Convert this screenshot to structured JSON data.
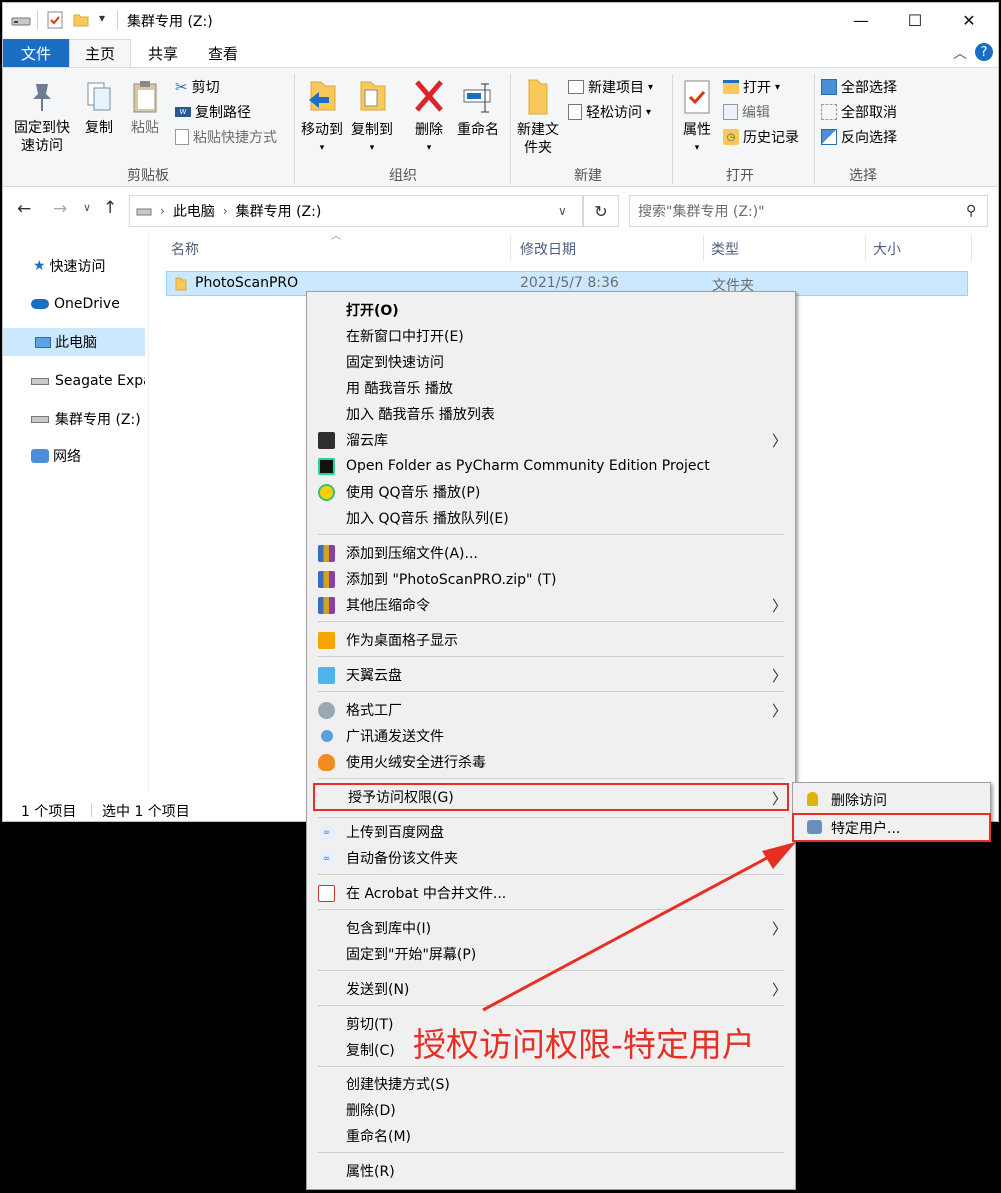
{
  "window": {
    "title": "集群专用 (Z:)",
    "controls": {
      "minimize": "—",
      "maximize": "☐",
      "close": "✕"
    }
  },
  "tabs": [
    {
      "label": "文件"
    },
    {
      "label": "主页"
    },
    {
      "label": "共享"
    },
    {
      "label": "查看"
    }
  ],
  "ribbon": {
    "clipboard": {
      "pin": "固定到快速访问",
      "copy": "复制",
      "paste": "粘贴",
      "cut": "剪切",
      "copy_path": "复制路径",
      "paste_shortcut": "粘贴快捷方式",
      "group": "剪贴板"
    },
    "organize": {
      "move_to": "移动到",
      "copy_to": "复制到",
      "delete": "删除",
      "rename": "重命名",
      "group": "组织"
    },
    "new": {
      "new_folder": "新建文件夹",
      "new_item": "新建项目",
      "easy_access": "轻松访问",
      "group": "新建"
    },
    "open": {
      "properties": "属性",
      "open": "打开",
      "edit": "编辑",
      "history": "历史记录",
      "group": "打开"
    },
    "select": {
      "select_all": "全部选择",
      "select_none": "全部取消",
      "invert": "反向选择",
      "group": "选择"
    }
  },
  "address": {
    "path": [
      "此电脑",
      "集群专用 (Z:)"
    ],
    "search_placeholder": "搜索\"集群专用 (Z:)\""
  },
  "nav": [
    {
      "label": "快速访问"
    },
    {
      "label": "OneDrive"
    },
    {
      "label": "此电脑"
    },
    {
      "label": "Seagate Expa"
    },
    {
      "label": "集群专用 (Z:)"
    },
    {
      "label": "网络"
    }
  ],
  "columns": {
    "name": "名称",
    "modified": "修改日期",
    "type": "类型",
    "size": "大小"
  },
  "files": [
    {
      "name": "PhotoScanPRO",
      "modified": "2021/5/7 8:36",
      "type": "文件夹"
    }
  ],
  "status": {
    "count": "1 个项目",
    "selected": "选中 1 个项目"
  },
  "menu": [
    {
      "label": "打开(O)"
    },
    {
      "label": "在新窗口中打开(E)"
    },
    {
      "label": "固定到快速访问"
    },
    {
      "label": "用 酷我音乐 播放"
    },
    {
      "label": "加入 酷我音乐 播放列表"
    },
    {
      "label": "溜云库"
    },
    {
      "label": "Open Folder as PyCharm Community Edition Project"
    },
    {
      "label": "使用 QQ音乐 播放(P)"
    },
    {
      "label": "加入 QQ音乐 播放队列(E)"
    },
    {
      "label": "添加到压缩文件(A)..."
    },
    {
      "label": "添加到 \"PhotoScanPRO.zip\" (T)"
    },
    {
      "label": "其他压缩命令"
    },
    {
      "label": "作为桌面格子显示"
    },
    {
      "label": "天翼云盘"
    },
    {
      "label": "格式工厂"
    },
    {
      "label": "广讯通发送文件"
    },
    {
      "label": "使用火绒安全进行杀毒"
    },
    {
      "label": "授予访问权限(G)"
    },
    {
      "label": "上传到百度网盘"
    },
    {
      "label": "自动备份该文件夹"
    },
    {
      "label": "在 Acrobat 中合并文件..."
    },
    {
      "label": "包含到库中(I)"
    },
    {
      "label": "固定到\"开始\"屏幕(P)"
    },
    {
      "label": "发送到(N)"
    },
    {
      "label": "剪切(T)"
    },
    {
      "label": "复制(C)"
    },
    {
      "label": "创建快捷方式(S)"
    },
    {
      "label": "删除(D)"
    },
    {
      "label": "重命名(M)"
    },
    {
      "label": "属性(R)"
    }
  ],
  "submenu": [
    {
      "label": "删除访问"
    },
    {
      "label": "特定用户..."
    }
  ],
  "annotation": "授权访问权限-特定用户",
  "colors": {
    "accent": "#1a6fc4",
    "selection": "#cce8ff",
    "highlight": "#e53023"
  }
}
